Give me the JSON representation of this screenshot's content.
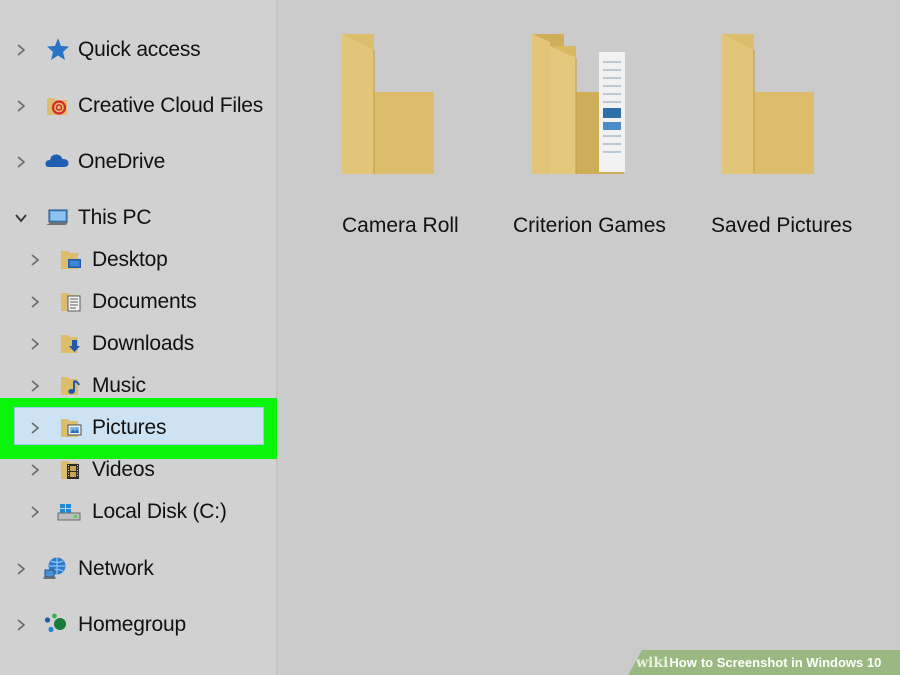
{
  "sidebar": {
    "items": [
      {
        "label": "Quick access",
        "icon": "star-icon",
        "chevron": "right"
      },
      {
        "label": "Creative Cloud Files",
        "icon": "creative-cloud-icon",
        "chevron": "right"
      },
      {
        "label": "OneDrive",
        "icon": "cloud-icon",
        "chevron": "right"
      },
      {
        "label": "This PC",
        "icon": "computer-icon",
        "chevron": "down"
      },
      {
        "label": "Desktop",
        "icon": "desktop-folder-icon",
        "chevron": "right"
      },
      {
        "label": "Documents",
        "icon": "documents-folder-icon",
        "chevron": "right"
      },
      {
        "label": "Downloads",
        "icon": "downloads-folder-icon",
        "chevron": "right"
      },
      {
        "label": "Music",
        "icon": "music-folder-icon",
        "chevron": "right"
      },
      {
        "label": "Pictures",
        "icon": "pictures-folder-icon",
        "chevron": "right",
        "selected": true
      },
      {
        "label": "Videos",
        "icon": "videos-folder-icon",
        "chevron": "right"
      },
      {
        "label": "Local Disk (C:)",
        "icon": "local-disk-icon",
        "chevron": "right"
      },
      {
        "label": "Network",
        "icon": "network-icon",
        "chevron": "right"
      },
      {
        "label": "Homegroup",
        "icon": "homegroup-icon",
        "chevron": "right"
      }
    ]
  },
  "main": {
    "folders": [
      {
        "label": "Camera Roll",
        "icon": "folder-icon"
      },
      {
        "label": "Criterion Games",
        "icon": "folder-with-files-icon"
      },
      {
        "label": "Saved Pictures",
        "icon": "folder-icon"
      }
    ]
  },
  "banner": {
    "brand": "wiki",
    "how": "How",
    "title": "to Screenshot in Windows 10"
  },
  "colors": {
    "highlight": "#0bf50b",
    "selection": "#cde3f4",
    "folder": "#dcbd6b",
    "folder_dark": "#c9a551",
    "background": "#cbcbcb"
  }
}
